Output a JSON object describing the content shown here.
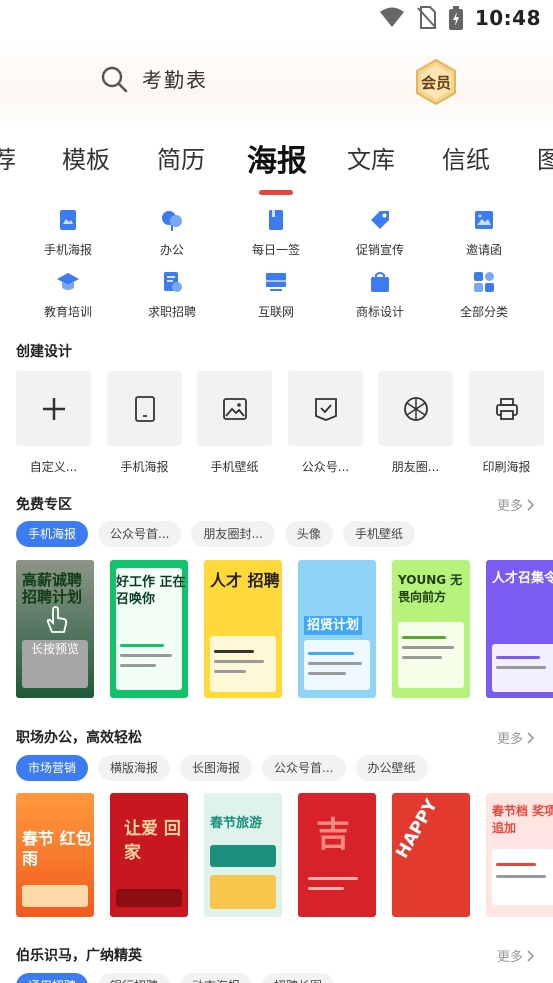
{
  "status_bar": {
    "time": "10:48"
  },
  "search": {
    "placeholder": "考勤表"
  },
  "vip": {
    "label": "会员"
  },
  "tabs": [
    {
      "label": "荐"
    },
    {
      "label": "模板"
    },
    {
      "label": "简历"
    },
    {
      "label": "海报"
    },
    {
      "label": "文库"
    },
    {
      "label": "信纸"
    },
    {
      "label": "图"
    }
  ],
  "categories": [
    {
      "label": "手机海报",
      "icon": "phone-poster-icon"
    },
    {
      "label": "办公",
      "icon": "office-icon"
    },
    {
      "label": "每日一签",
      "icon": "daily-sign-icon"
    },
    {
      "label": "促销宣传",
      "icon": "promotion-tag-icon"
    },
    {
      "label": "邀请函",
      "icon": "invitation-icon"
    },
    {
      "label": "教育培训",
      "icon": "education-cap-icon"
    },
    {
      "label": "求职招聘",
      "icon": "recruit-icon"
    },
    {
      "label": "互联网",
      "icon": "internet-icon"
    },
    {
      "label": "商标设计",
      "icon": "logo-design-icon"
    },
    {
      "label": "全部分类",
      "icon": "all-categories-icon"
    }
  ],
  "create": {
    "title": "创建设计",
    "items": [
      {
        "label": "自定义...",
        "icon": "plus-icon"
      },
      {
        "label": "手机海报",
        "icon": "tablet-icon"
      },
      {
        "label": "手机壁纸",
        "icon": "image-icon"
      },
      {
        "label": "公众号...",
        "icon": "check-doc-icon"
      },
      {
        "label": "朋友圈...",
        "icon": "aperture-icon"
      },
      {
        "label": "印刷海报",
        "icon": "printer-icon"
      }
    ]
  },
  "free": {
    "title": "免费专区",
    "more": "更多",
    "chips": [
      "手机海报",
      "公众号首...",
      "朋友圈封...",
      "头像",
      "手机壁纸"
    ],
    "overlay_label": "长按预览",
    "thumbs": [
      {
        "text": "高薪诚聘 招聘计划"
      },
      {
        "text": "好工作 正在召唤你"
      },
      {
        "text": "人才 招聘"
      },
      {
        "text": "招贤计划"
      },
      {
        "text": "YOUNG 无畏向前方"
      },
      {
        "text": "人才召集令"
      }
    ]
  },
  "office": {
    "title": "职场办公，高效轻松",
    "more": "更多",
    "chips": [
      "市场营销",
      "横版海报",
      "长图海报",
      "公众号首...",
      "办公壁纸"
    ],
    "thumbs": [
      {
        "text": "春节 红包雨"
      },
      {
        "text": "让爱 回家"
      },
      {
        "text": "春节旅游"
      },
      {
        "text": "吉"
      },
      {
        "text": "HAPPY"
      },
      {
        "text": "春节档 奖项追加"
      }
    ]
  },
  "recruit": {
    "title": "伯乐识马，广纳精英",
    "more": "更多",
    "chips": [
      "通用招聘",
      "银行招聘",
      "动态海报",
      "招聘长图"
    ]
  },
  "colors": {
    "accent": "#3d7cf0",
    "tab_underline": "#e5463c"
  }
}
